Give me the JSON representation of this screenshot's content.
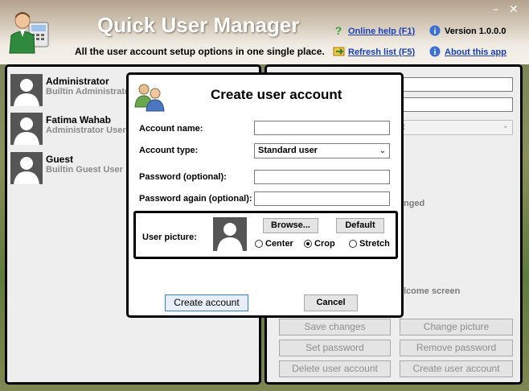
{
  "window": {
    "minimize_glyph": "–",
    "close_glyph": "✕"
  },
  "header": {
    "title": "Quick User Manager",
    "subtitle": "All the user account setup options in one single place.",
    "online_help": "Online help (F1)",
    "refresh": "Refresh list (F5)",
    "version": "Version 1.0.0.0",
    "about": "About this app"
  },
  "users": [
    {
      "name": "Administrator",
      "desc": "Builtin Administrator"
    },
    {
      "name": "Fatima Wahab",
      "desc": "Administrator User"
    },
    {
      "name": "Guest",
      "desc": "Builtin Guest User"
    }
  ],
  "right_panel": {
    "partial_labels": {
      "changed": "nged",
      "welcome": "lcome screen",
      "select_tail": "t"
    },
    "buttons": {
      "save_changes": "Save changes",
      "change_picture": "Change picture",
      "set_password": "Set password",
      "remove_password": "Remove password",
      "delete_user": "Delete user account",
      "create_user": "Create user account"
    }
  },
  "dialog": {
    "title": "Create user account",
    "account_name_label": "Account name:",
    "account_name_value": "",
    "account_type_label": "Account type:",
    "account_type_value": "Standard user",
    "password_label": "Password (optional):",
    "password_again_label": "Password again (optional):",
    "user_picture_label": "User picture:",
    "browse": "Browse...",
    "default": "Default",
    "radio_center": "Center",
    "radio_crop": "Crop",
    "radio_stretch": "Stretch",
    "selected_fit": "Crop",
    "create_button": "Create account",
    "cancel_button": "Cancel"
  }
}
